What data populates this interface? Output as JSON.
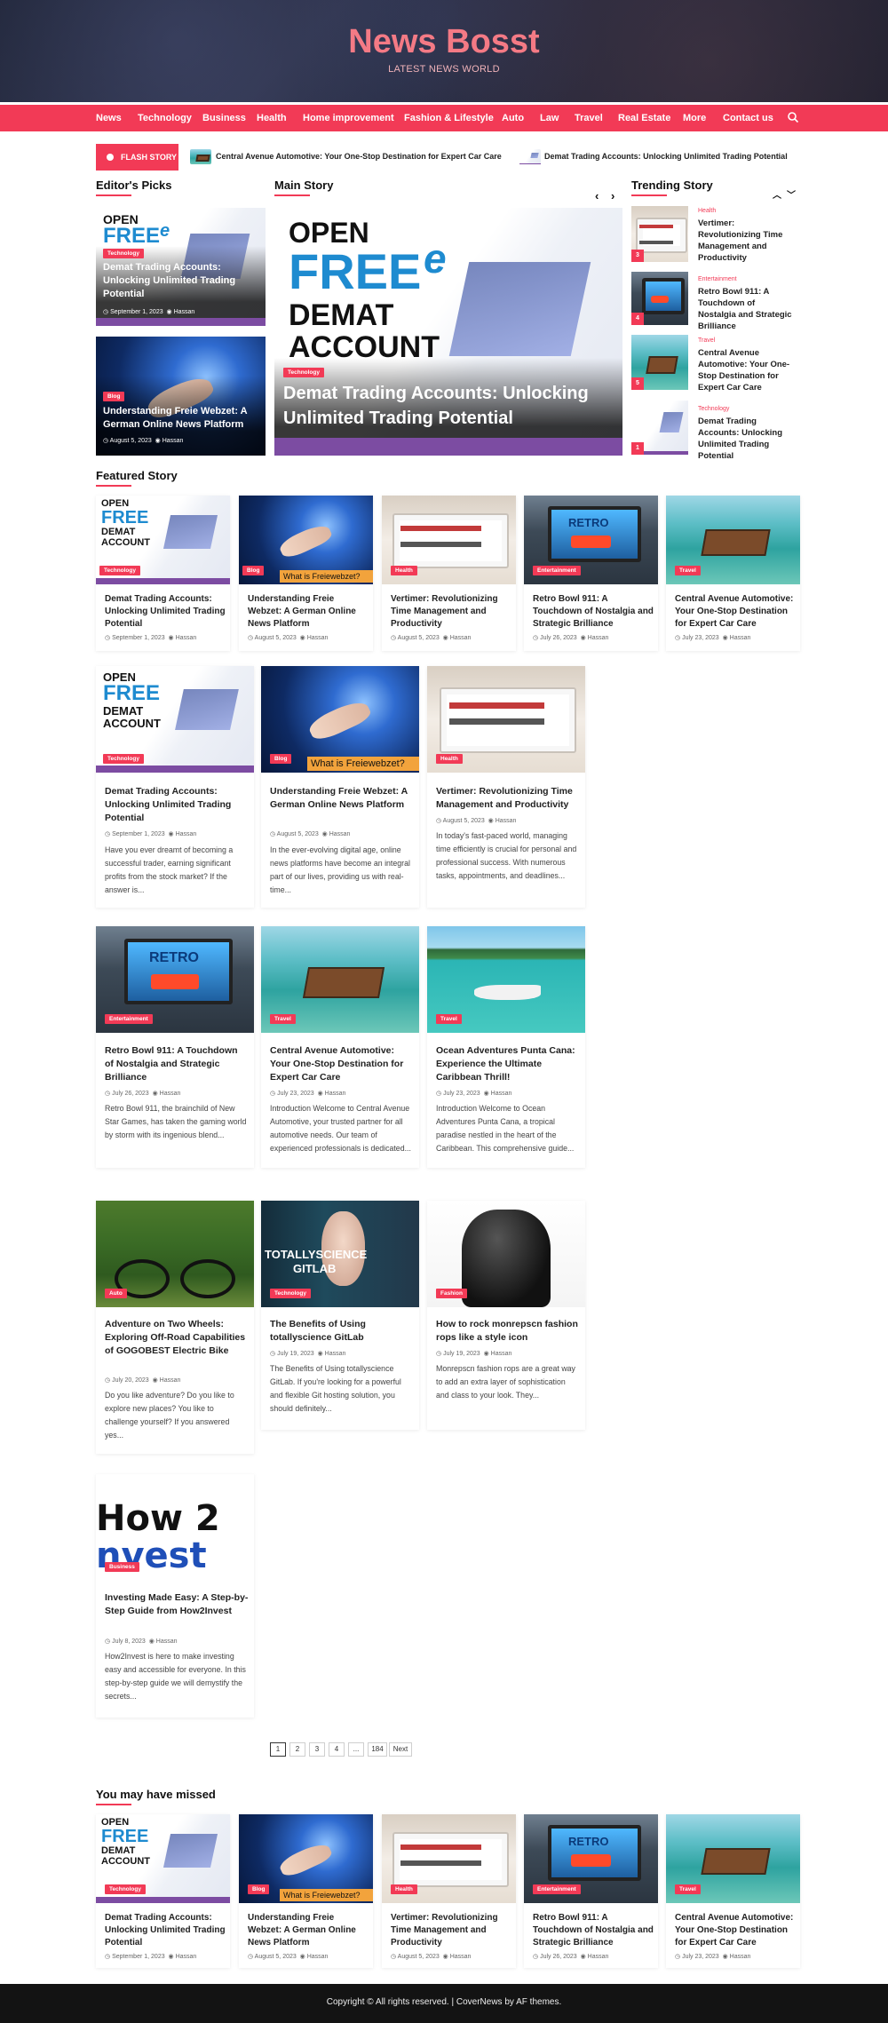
{
  "site": {
    "title": "News Bosst",
    "tagline": "LATEST NEWS WORLD"
  },
  "nav": {
    "items": [
      "News",
      "Technology",
      "Business",
      "Health",
      "Home improvement",
      "Fashion & Lifestyle",
      "Auto",
      "Law",
      "Travel",
      "Real Estate",
      "More",
      "Contact us"
    ],
    "search_icon": "search-icon"
  },
  "flash": {
    "label": "FLASH STORY",
    "items": [
      "Central Avenue Automotive: Your One-Stop Destination for Expert Car Care",
      "Demat Trading Accounts: Unlocking Unlimited Trading Potential"
    ]
  },
  "image_text": {
    "open": "OPEN",
    "free": "FREE",
    "e": "e",
    "demat": "DEMAT",
    "account": "ACCOUNT",
    "freiewebzet": "What is Freiewebzet?",
    "retro": "RETRO",
    "bowl": "BOWL",
    "gitlab1": "TOTALLYSCIENCE",
    "gitlab2": "GITLAB",
    "how1": "How 2",
    "how2": "nvest"
  },
  "editors_picks": {
    "title": "Editor's Picks",
    "items": [
      {
        "category": "Technology",
        "title": "Demat Trading Accounts: Unlocking Unlimited Trading Potential",
        "date": "September 1, 2023",
        "author": "Hassan"
      },
      {
        "category": "Blog",
        "title": "Understanding Freie Webzet: A German Online News Platform",
        "date": "August 5, 2023",
        "author": "Hassan"
      }
    ]
  },
  "main_story": {
    "title": "Main Story",
    "category": "Technology",
    "headline": "Demat Trading Accounts: Unlocking Unlimited Trading Potential",
    "date": "September 1, 2023",
    "author": "Hassan"
  },
  "trending": {
    "title": "Trending Story",
    "items": [
      {
        "num": "3",
        "category": "Health",
        "title": "Vertimer: Revolutionizing Time Management and Productivity"
      },
      {
        "num": "4",
        "category": "Entertainment",
        "title": "Retro Bowl 911: A Touchdown of Nostalgia and Strategic Brilliance"
      },
      {
        "num": "5",
        "category": "Travel",
        "title": "Central Avenue Automotive: Your One-Stop Destination for Expert Car Care"
      },
      {
        "num": "1",
        "category": "Technology",
        "title": "Demat Trading Accounts: Unlocking Unlimited Trading Potential"
      }
    ]
  },
  "featured": {
    "title": "Featured Story",
    "items": [
      {
        "category": "Technology",
        "title": "Demat Trading Accounts: Unlocking Unlimited Trading Potential",
        "date": "September 1, 2023",
        "author": "Hassan"
      },
      {
        "category": "Blog",
        "title": "Understanding Freie Webzet: A German Online News Platform",
        "date": "August 5, 2023",
        "author": "Hassan"
      },
      {
        "category": "Health",
        "title": "Vertimer: Revolutionizing Time Management and Productivity",
        "date": "August 5, 2023",
        "author": "Hassan"
      },
      {
        "category": "Entertainment",
        "title": "Retro Bowl 911: A Touchdown of Nostalgia and Strategic Brilliance",
        "date": "July 26, 2023",
        "author": "Hassan"
      },
      {
        "category": "Travel",
        "title": "Central Avenue Automotive: Your One-Stop Destination for Expert Car Care",
        "date": "July 23, 2023",
        "author": "Hassan"
      }
    ]
  },
  "posts": [
    {
      "category": "Technology",
      "title": "Demat Trading Accounts: Unlocking Unlimited Trading Potential",
      "date": "September 1, 2023",
      "author": "Hassan",
      "excerpt": "Have you ever dreamt of becoming a successful trader, earning significant profits from the stock market? If the answer is..."
    },
    {
      "category": "Blog",
      "title": "Understanding Freie Webzet: A German Online News Platform",
      "date": "August 5, 2023",
      "author": "Hassan",
      "excerpt": "In the ever-evolving digital age, online news platforms have become an integral part of our lives, providing us with real-time..."
    },
    {
      "category": "Health",
      "title": "Vertimer: Revolutionizing Time Management and Productivity",
      "date": "August 5, 2023",
      "author": "Hassan",
      "excerpt": "In today's fast-paced world, managing time efficiently is crucial for personal and professional success. With numerous tasks, appointments, and deadlines..."
    },
    {
      "category": "Entertainment",
      "title": "Retro Bowl 911: A Touchdown of Nostalgia and Strategic Brilliance",
      "date": "July 26, 2023",
      "author": "Hassan",
      "excerpt": "Retro Bowl 911, the brainchild of New Star Games, has taken the gaming world by storm with its ingenious blend..."
    },
    {
      "category": "Travel",
      "title": "Central Avenue Automotive: Your One-Stop Destination for Expert Car Care",
      "date": "July 23, 2023",
      "author": "Hassan",
      "excerpt": "Introduction Welcome to Central Avenue Automotive, your trusted partner for all automotive needs. Our team of experienced professionals is dedicated..."
    },
    {
      "category": "Travel",
      "title": "Ocean Adventures Punta Cana: Experience the Ultimate Caribbean Thrill!",
      "date": "July 23, 2023",
      "author": "Hassan",
      "excerpt": "Introduction Welcome to Ocean Adventures Punta Cana, a tropical paradise nestled in the heart of the Caribbean. This comprehensive guide..."
    },
    {
      "category": "Auto",
      "title": "Adventure on Two Wheels: Exploring Off-Road Capabilities of GOGOBEST Electric Bike",
      "date": "July 20, 2023",
      "author": "Hassan",
      "excerpt": "Do you like adventure? Do you like to explore new places? You like to challenge yourself? If you answered yes..."
    },
    {
      "category": "Technology",
      "title": "The Benefits of Using totallyscience GitLab",
      "date": "July 19, 2023",
      "author": "Hassan",
      "excerpt": "The Benefits of Using totallyscience GitLab. If you're looking for a powerful and flexible Git hosting solution, you should definitely..."
    },
    {
      "category": "Fashion",
      "title": "How to rock monrepscn fashion rops like a style icon",
      "date": "July 19, 2023",
      "author": "Hassan",
      "excerpt": "Monrepscn fashion rops are a great way to add an extra layer of sophistication and class to your look. They..."
    },
    {
      "category": "Business",
      "title": "Investing Made Easy: A Step-by-Step Guide from How2Invest",
      "date": "July 8, 2023",
      "author": "Hassan",
      "excerpt": "How2Invest is here to make investing easy and accessible for everyone. In this step-by-step guide we will demystify the secrets..."
    }
  ],
  "pagination": {
    "pages": [
      "1",
      "2",
      "3",
      "4",
      "...",
      "184",
      "Next"
    ]
  },
  "missed": {
    "title": "You may have missed",
    "items": [
      {
        "category": "Technology",
        "title": "Demat Trading Accounts: Unlocking Unlimited Trading Potential",
        "date": "September 1, 2023",
        "author": "Hassan"
      },
      {
        "category": "Blog",
        "title": "Understanding Freie Webzet: A German Online News Platform",
        "date": "August 5, 2023",
        "author": "Hassan"
      },
      {
        "category": "Health",
        "title": "Vertimer: Revolutionizing Time Management and Productivity",
        "date": "August 5, 2023",
        "author": "Hassan"
      },
      {
        "category": "Entertainment",
        "title": "Retro Bowl 911: A Touchdown of Nostalgia and Strategic Brilliance",
        "date": "July 26, 2023",
        "author": "Hassan"
      },
      {
        "category": "Travel",
        "title": "Central Avenue Automotive: Your One-Stop Destination for Expert Car Care",
        "date": "July 23, 2023",
        "author": "Hassan"
      }
    ]
  },
  "footer": {
    "text": "Copyright © All rights reserved. | CoverNews by AF themes."
  },
  "colors": {
    "accent": "#f23a56",
    "footer": "#131313",
    "title": "#f47a85"
  }
}
